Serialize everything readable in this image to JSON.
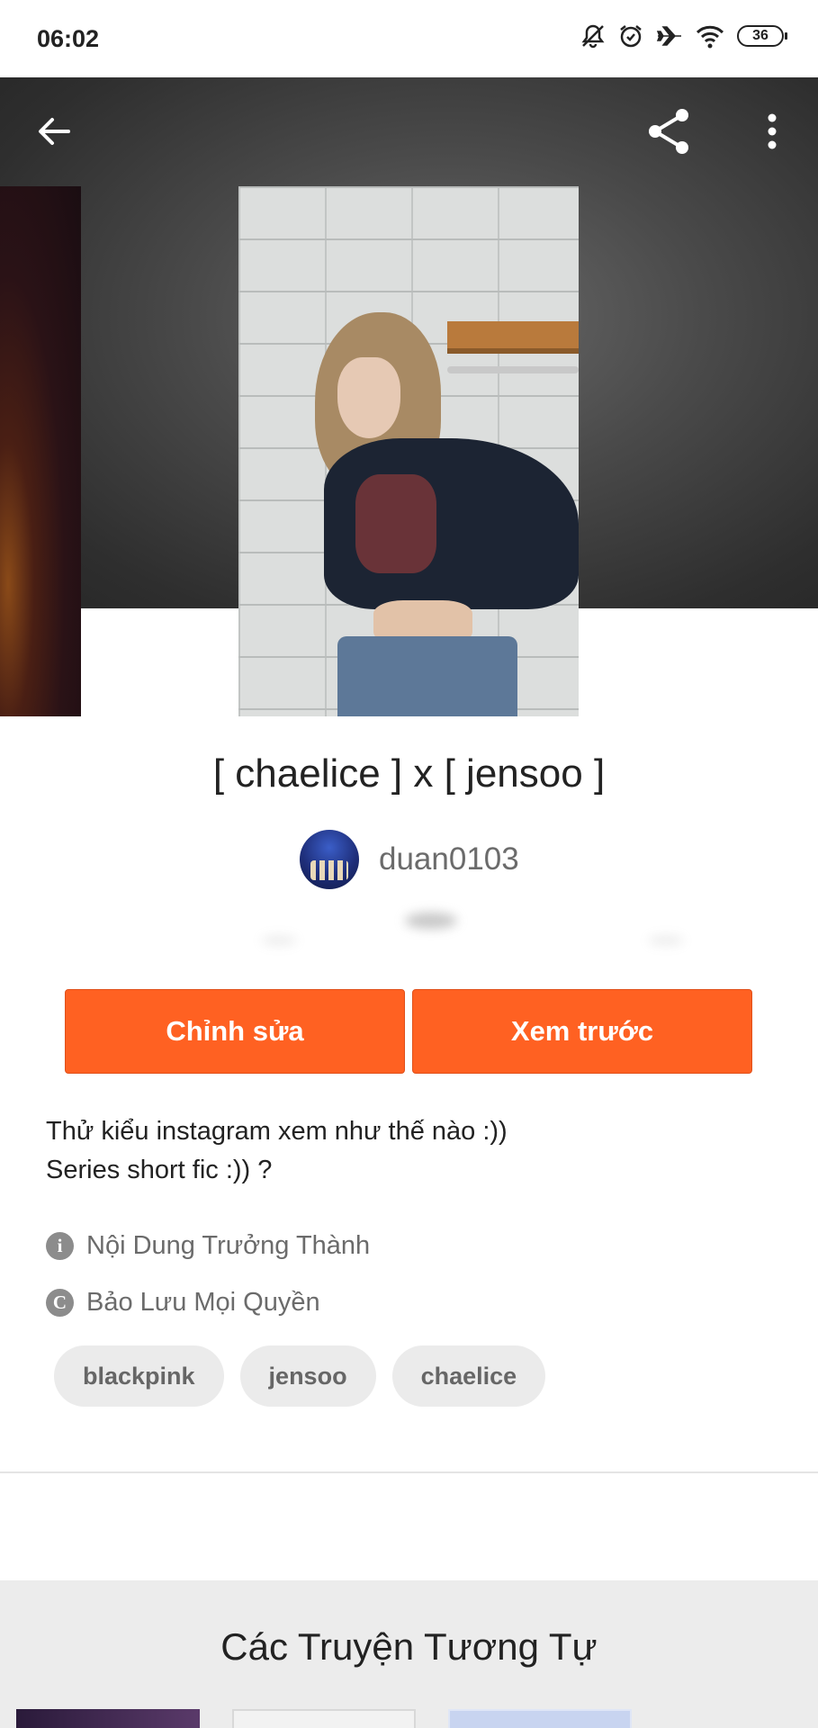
{
  "status_bar": {
    "time": "06:02",
    "battery": "36",
    "icons": [
      "bell-off-icon",
      "alarm-icon",
      "airplane-icon",
      "wifi-icon",
      "battery-icon"
    ]
  },
  "header": {
    "icons": [
      "back-arrow-icon",
      "share-icon",
      "more-vertical-icon"
    ]
  },
  "story": {
    "title": "[ chaelice ] x [ jensoo ]",
    "author": "duan0103",
    "description_lines": [
      "Thử kiểu instagram xem như thế nào :))",
      "Series short fic :)) ?"
    ],
    "rating_label": "Nội Dung Trưởng Thành",
    "rating_icon": "i",
    "copyright_label": "Bảo Lưu Mọi Quyền",
    "copyright_icon": "C",
    "tags": [
      "blackpink",
      "jensoo",
      "chaelice"
    ]
  },
  "actions": {
    "edit_label": "Chỉnh sửa",
    "preview_label": "Xem trước"
  },
  "similar": {
    "title": "Các Truyện Tương Tự"
  },
  "colors": {
    "accent": "#ff6122",
    "tag_bg": "#ebebeb",
    "section_bg": "#ececec"
  }
}
